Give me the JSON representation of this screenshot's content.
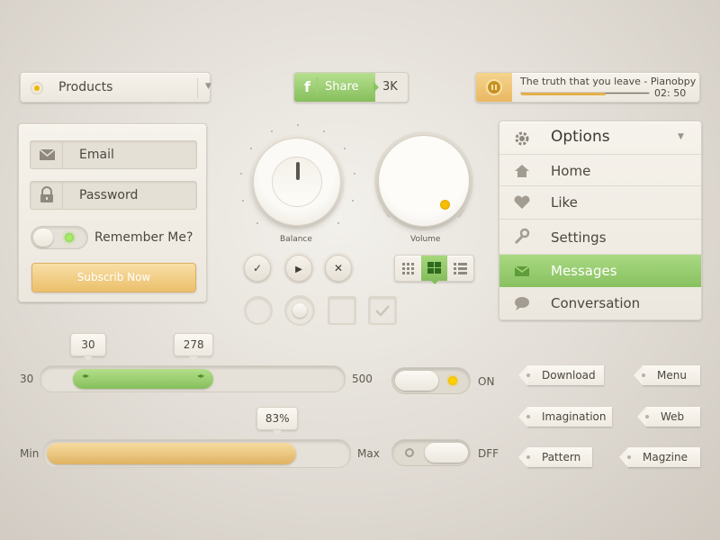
{
  "products": {
    "label": "Products"
  },
  "share": {
    "icon": "f",
    "label": "Share",
    "count": "3K"
  },
  "player": {
    "title": "The truth that you leave - Pianobpy",
    "time": "02: 50",
    "progress": 0.66
  },
  "login": {
    "email_placeholder": "Email",
    "password_placeholder": "Password",
    "remember_label": "Remember Me?",
    "remember_on": true,
    "subscribe_label": "Subscrib Now"
  },
  "knobs": {
    "balance_label": "Balance",
    "volume_label": "Volume"
  },
  "controls": {
    "check": "✓",
    "play": "▶",
    "close": "✕"
  },
  "range_slider": {
    "min_label": "30",
    "max_label": "500",
    "low": "30",
    "high": "278",
    "min": 30,
    "max": 500,
    "low_value": 30,
    "high_value": 278
  },
  "progress_slider": {
    "min_label": "Min",
    "max_label": "Max",
    "value_label": "83%",
    "value": 0.83
  },
  "toggles": {
    "on_label": "ON",
    "off_label": "DFF"
  },
  "options": {
    "title": "Options",
    "items": [
      {
        "label": "Home",
        "icon": "home-icon"
      },
      {
        "label": "Like",
        "icon": "heart-icon"
      },
      {
        "label": "Settings",
        "icon": "wrench-icon"
      },
      {
        "label": "Messages",
        "icon": "envelope-icon",
        "active": true
      },
      {
        "label": "Conversation",
        "icon": "speech-bubble-icon"
      }
    ]
  },
  "tags": [
    "Download",
    "Menu",
    "Imagination",
    "Web",
    "Pattern",
    "Magzine"
  ],
  "colors": {
    "accent_green": "#88c160",
    "accent_orange": "#ebbf6b",
    "accent_yellow": "#f1b500"
  }
}
